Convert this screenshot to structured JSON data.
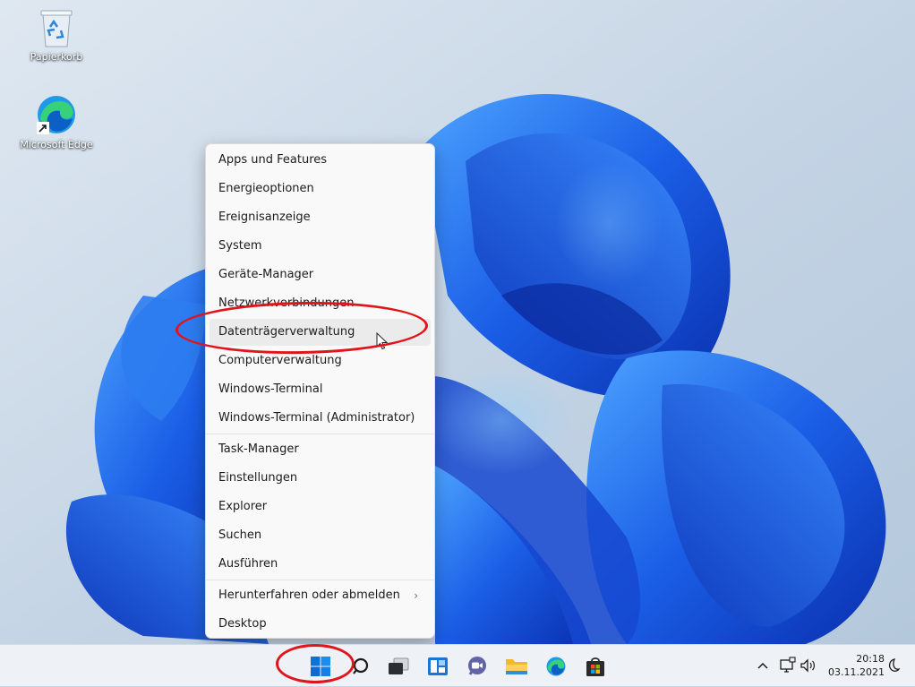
{
  "desktop": {
    "icons": [
      {
        "label": "Papierkorb",
        "icon": "recycle-bin-icon"
      },
      {
        "label": "Microsoft Edge",
        "icon": "edge-icon"
      }
    ]
  },
  "context_menu": {
    "groups": [
      [
        "Apps und Features",
        "Energieoptionen",
        "Ereignisanzeige",
        "System",
        "Geräte-Manager",
        "Netzwerkverbindungen",
        "Datenträgerverwaltung",
        "Computerverwaltung",
        "Windows-Terminal",
        "Windows-Terminal (Administrator)"
      ],
      [
        "Task-Manager",
        "Einstellungen",
        "Explorer",
        "Suchen",
        "Ausführen"
      ],
      [
        "Herunterfahren oder abmelden",
        "Desktop"
      ]
    ],
    "highlighted": "Datenträgerverwaltung",
    "submenu_item": "Herunterfahren oder abmelden"
  },
  "taskbar": {
    "apps": [
      "start-icon",
      "search-icon",
      "task-view-icon",
      "widgets-icon",
      "teams-chat-icon",
      "file-explorer-icon",
      "edge-icon",
      "store-icon"
    ],
    "clock": {
      "time": "20:18",
      "date": "03.11.2021"
    }
  },
  "annotations": {
    "color": "#e0151b"
  },
  "colors": {
    "accent": "#0067c0",
    "wallpaper_bg": "#c6d6e6"
  }
}
